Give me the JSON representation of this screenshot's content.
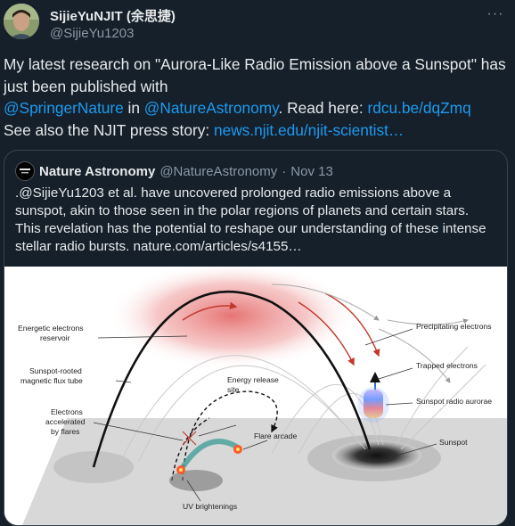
{
  "author": {
    "name": "SijieYuNJIT (余思捷)",
    "handle": "@SijieYu1203",
    "more_icon": "ellipsis-icon"
  },
  "tweet": {
    "text_1": "My latest research on \"Aurora-Like Radio Emission above a Sunspot\" has just been published with",
    "mention_1": "@SpringerNature",
    "text_2": " in ",
    "mention_2": "@NatureAstronomy",
    "text_3": ". Read here: ",
    "link_1": "rdcu.be/dqZmq",
    "text_4": "See also the NJIT press story: ",
    "link_2": "news.njit.edu/njit-scientist…"
  },
  "quote": {
    "name": "Nature Astronomy",
    "handle": "@NatureAstronomy",
    "separator": "·",
    "date": "Nov 13",
    "text": ".@SijieYu1203 et al. have uncovered prolonged radio emissions above a sunspot, akin to those seen in the polar regions of planets and certain stars. This revelation has the potential to reshape our understanding of these intense stellar radio bursts. nature.com/articles/s4155…"
  },
  "figure": {
    "labels": {
      "energetic": [
        "Energetic electrons",
        "reservoir"
      ],
      "fluxtube": [
        "Sunspot-rooted",
        "magnetic flux tube"
      ],
      "accelerated": [
        "Electrons",
        "accelerated",
        "by flares"
      ],
      "energy_release": [
        "Energy release",
        "site"
      ],
      "flare_arcade": "Flare arcade",
      "uv": "UV brightenings",
      "precipitating": "Precipitating electrons",
      "trapped": "Trapped electrons",
      "aurorae": "Sunspot radio aurorae",
      "sunspot": "Sunspot"
    }
  },
  "colors": {
    "background": "#15202b",
    "link": "#1d9bf0",
    "text": "#e7e9ea",
    "muted": "#8b98a5"
  }
}
